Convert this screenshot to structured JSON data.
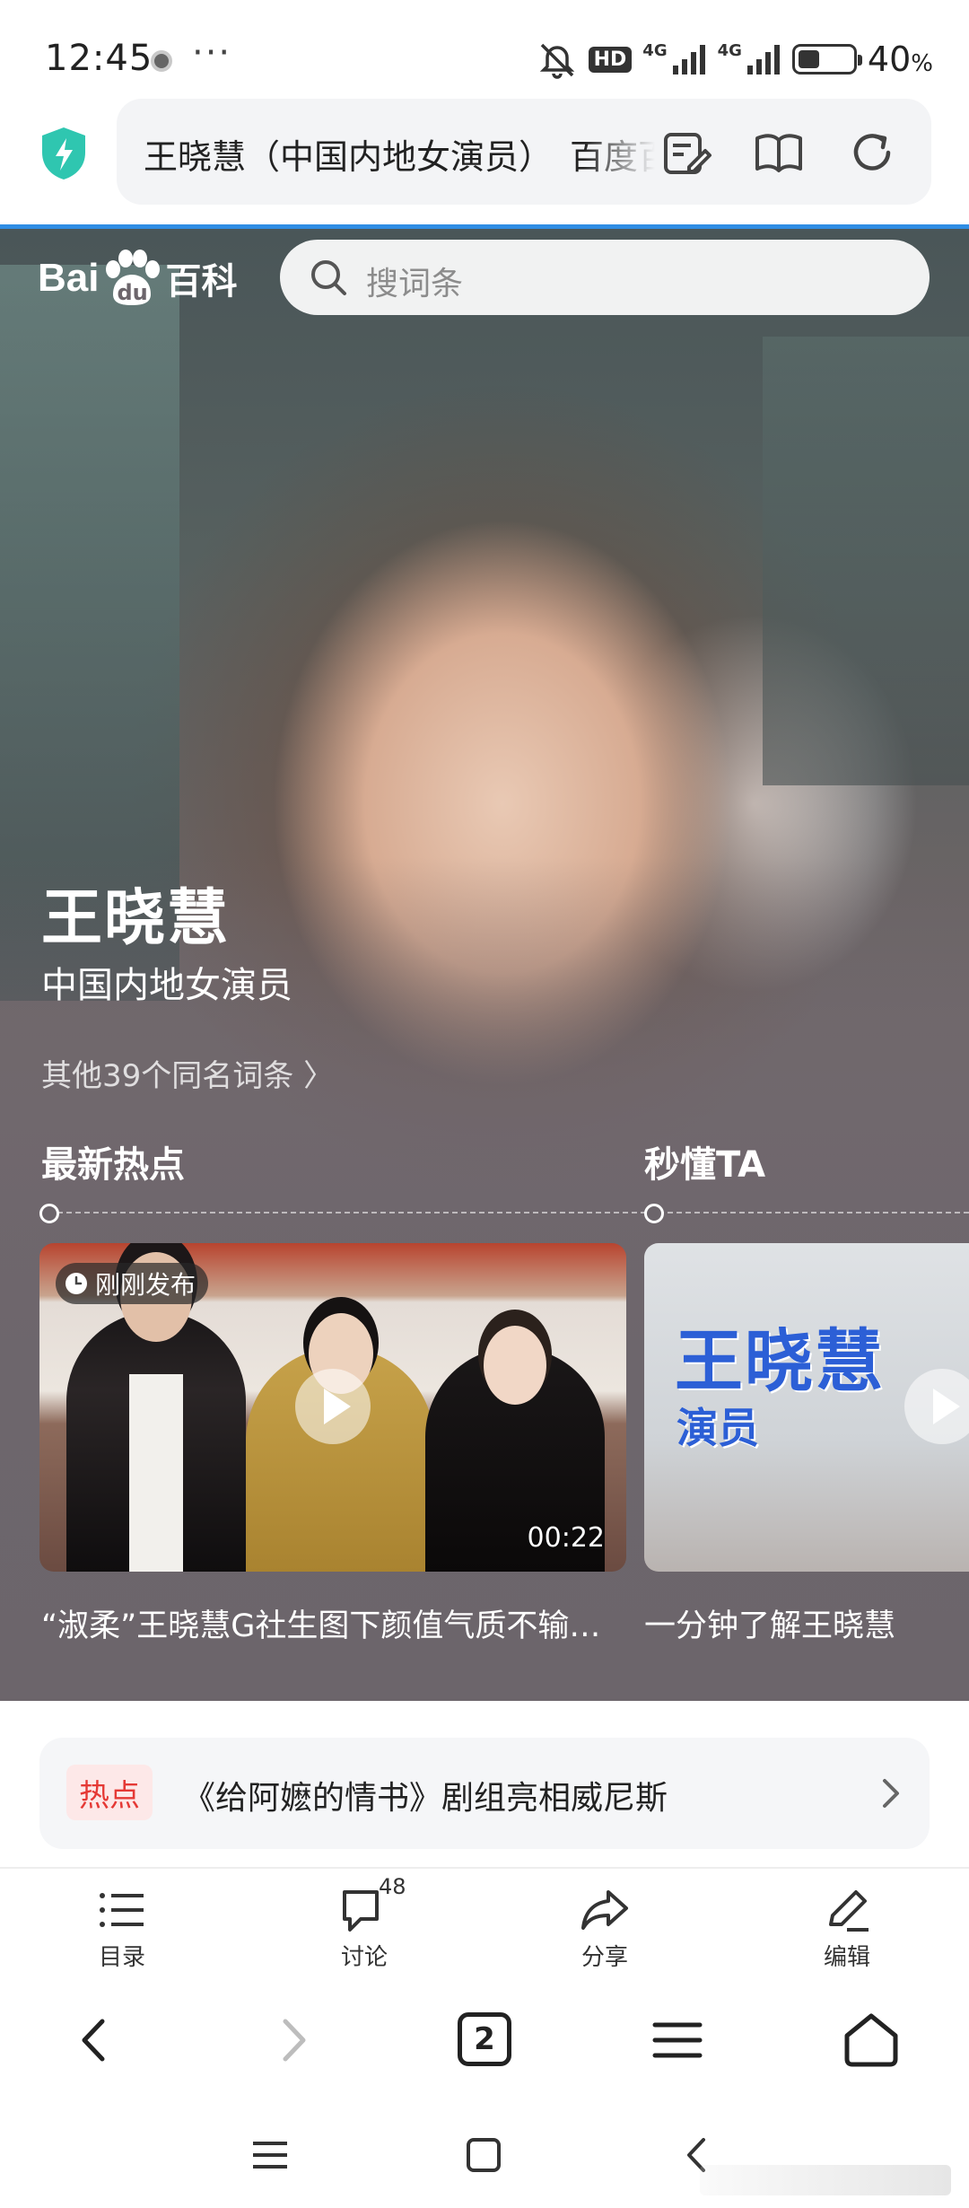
{
  "status_bar": {
    "time": "12:45",
    "more": "···",
    "hd_label": "HD",
    "network_1": "4G",
    "network_2": "4G",
    "battery_percent": "40",
    "battery_unit": "%",
    "battery_level": 0.4
  },
  "address_bar": {
    "url_text": "王晓慧（中国内地女演员）_百度百科",
    "icons": [
      "shield-icon",
      "edit-note-icon",
      "reader-mode-icon",
      "refresh-icon"
    ]
  },
  "baike": {
    "logo_text_bai": "Bai",
    "logo_text_du": "du",
    "logo_text_baike": "百科",
    "search_placeholder": "搜词条"
  },
  "entry": {
    "name": "王晓慧",
    "subtitle": "中国内地女演员",
    "other_entries": "其他39个同名词条 〉"
  },
  "sections": {
    "latest_hot": "最新热点",
    "quick_know": "秒懂TA"
  },
  "cards": [
    {
      "badge": "刚刚发布",
      "duration": "00:22",
      "caption": "“淑柔”王晓慧G社生图下颜值气质不输…"
    },
    {
      "title": "王晓慧",
      "subtitle": "演员",
      "caption": "一分钟了解王晓慧"
    }
  ],
  "hot_banner": {
    "tag": "热点",
    "text": "《给阿嬷的情书》剧组亮相威尼斯"
  },
  "toolbar": [
    {
      "label": "目录",
      "icon": "list-icon"
    },
    {
      "label": "讨论",
      "icon": "comment-icon",
      "count": "48"
    },
    {
      "label": "分享",
      "icon": "share-icon"
    },
    {
      "label": "编辑",
      "icon": "edit-icon"
    }
  ],
  "browser_nav": {
    "tabs_count": "2",
    "icons": [
      "back-icon",
      "forward-icon",
      "tabs-icon",
      "menu-icon",
      "home-icon"
    ]
  },
  "colors": {
    "accent_blue": "#2f8de4",
    "hot_red": "#e53935",
    "card_title_blue": "#2c5fd6"
  }
}
